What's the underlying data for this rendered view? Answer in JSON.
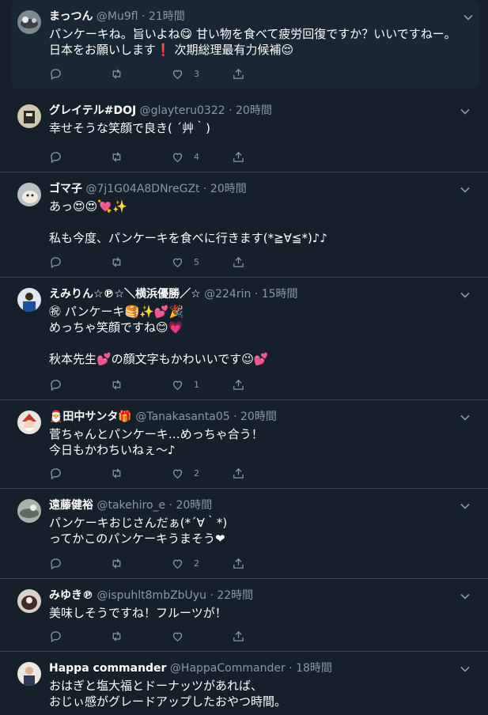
{
  "tweets": [
    {
      "name": "まっつん",
      "handle": "@Mu9fl",
      "time": "· 21時間",
      "text": "パンケーキね。旨いよね😋 甘い物を食べて疲労回復ですか？いいですねー。\n日本をお願いします❗ 次期総理最有力候補😌",
      "likes": "3",
      "avatar_color": "#6e7b82"
    },
    {
      "name": "グレイテル#DOJ",
      "handle": "@glayteru0322",
      "time": "· 20時間",
      "text": "幸せそうな笑顔で良き( ´艸｀)",
      "likes": "4",
      "avatar_color": "#8a7f6a"
    },
    {
      "name": "ゴマ子",
      "handle": "@7j1G04A8DNreGZt",
      "time": "· 20時間",
      "text": "あっ😍😍💘✨\n\n私も今度、パンケーキを食べに行きます(*≧∀≦*)♪♪",
      "likes": "5",
      "avatar_color": "#9aa3a8"
    },
    {
      "name": "えみりん☆℗☆＼横浜優勝／☆",
      "handle": "@224rin",
      "time": "· 15時間",
      "text": "㊗ パンケーキ🥞✨💕🎉\nめっちゃ笑顔ですね😊💗\n\n秋本先生💕の顔文字もかわいいです😉💕",
      "likes": "1",
      "avatar_color": "#2b4e8a"
    },
    {
      "name": "🎅田中サンタ🎁",
      "handle": "@Tanakasanta05",
      "time": "· 20時間",
      "text": "菅ちゃんとパンケーキ…めっちゃ合う！\n今日もかわちいねぇ〜♪",
      "likes": "2",
      "avatar_color": "#c0392b"
    },
    {
      "name": "遠藤健裕",
      "handle": "@takehiro_e",
      "time": "· 20時間",
      "text": "パンケーキおじさんだぁ(*´∀｀*)\nってかこのパンケーキうまそう❤",
      "likes": "2",
      "avatar_color": "#8d9a92"
    },
    {
      "name": "みゆき℗",
      "handle": "@ispuhlt8mbZbUyu",
      "time": "· 22時間",
      "text": "美味しそうですね！フルーツが！",
      "likes": "",
      "avatar_color": "#5a4d4a"
    },
    {
      "name": "Happa commander",
      "handle": "@HappaCommander",
      "time": "· 18時間",
      "text": "おはぎと塩大福とドーナッツがあれば、\nおじぃ感がグレードアップしたおやつ時間。",
      "likes": "",
      "avatar_color": "#d9d4c8"
    }
  ]
}
